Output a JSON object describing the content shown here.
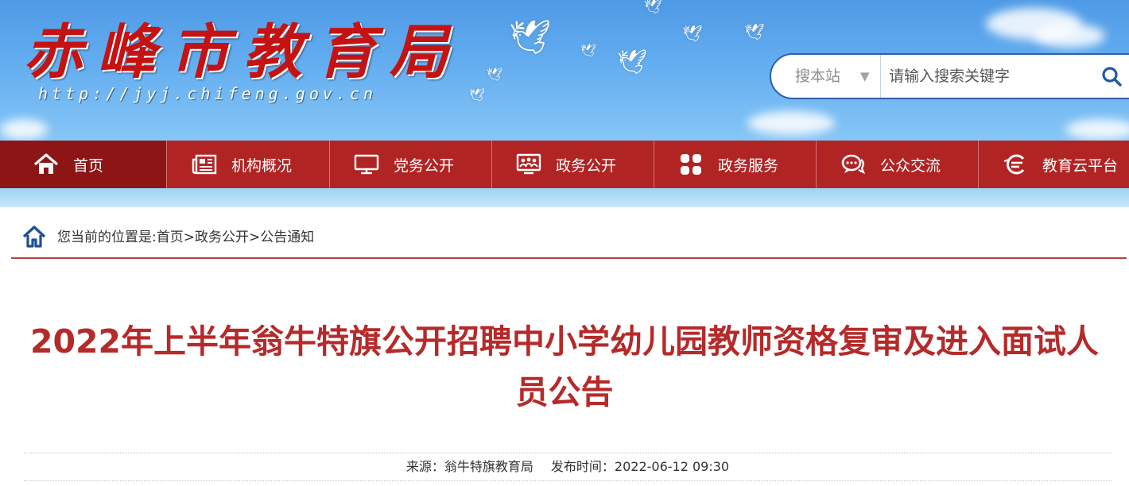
{
  "site": {
    "logo_text": "赤峰市教育局",
    "url_text": "http://jyj.chifeng.gov.cn"
  },
  "search": {
    "scope_label": "搜本站",
    "scope_arrow": "▼",
    "placeholder": "请输入搜索关键字",
    "icon": "search-icon"
  },
  "nav": {
    "items": [
      {
        "label": "首页",
        "icon": "home-icon",
        "active": true
      },
      {
        "label": "机构概况",
        "icon": "newspaper-icon"
      },
      {
        "label": "党务公开",
        "icon": "monitor-icon"
      },
      {
        "label": "政务公开",
        "icon": "people-screen-icon"
      },
      {
        "label": "政务服务",
        "icon": "grid-icon"
      },
      {
        "label": "公众交流",
        "icon": "chat-icon"
      },
      {
        "label": "教育云平台",
        "icon": "education-cloud-icon"
      }
    ]
  },
  "breadcrumb": {
    "prefix": "您当前的位置是:",
    "items": [
      "首页",
      "政务公开",
      "公告通知"
    ],
    "separator": ">"
  },
  "article": {
    "title": "2022年上半年翁牛特旗公开招聘中小学幼儿园教师资格复审及进入面试人员公告",
    "source_label": "来源：",
    "source": "翁牛特旗教育局",
    "date_label": "发布时间：",
    "date": "2022-06-12 09:30"
  },
  "colors": {
    "nav_bg": "#b12424",
    "nav_active": "#8e1515",
    "title": "#b52a2a",
    "breadcrumb_rule": "#b84040",
    "search_border": "#2c5fa8"
  }
}
